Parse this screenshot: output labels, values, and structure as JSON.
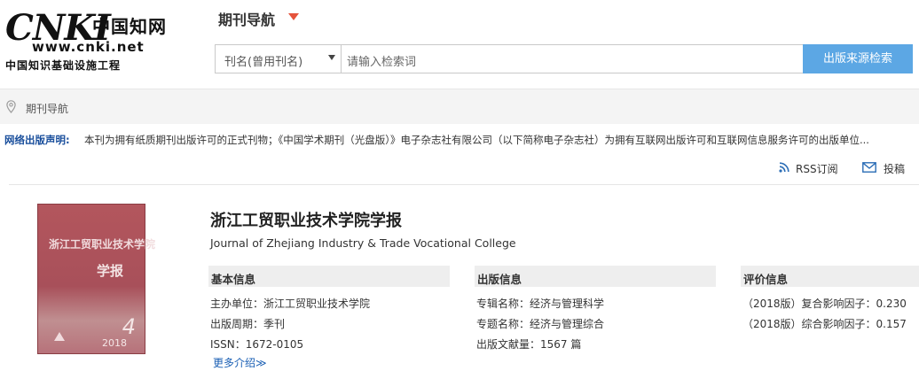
{
  "header": {
    "logo": {
      "brand": "CNKI",
      "cn_name": "中国知网",
      "url": "www.cnki.net",
      "slogan": "中国知识基础设施工程"
    },
    "nav_title": "期刊导航",
    "search": {
      "scope_selected": "刊名(曾用刊名)",
      "placeholder": "请输入检索词",
      "button_label": "出版来源检索"
    }
  },
  "breadcrumb": {
    "label": "期刊导航"
  },
  "notice": {
    "label": "网络出版声明:",
    "text": "本刊为拥有纸质期刊出版许可的正式刊物；《中国学术期刊（光盘版）》电子杂志社有限公司（以下简称电子杂志社）为拥有互联网出版许可和互联网信息服务许可的出版单位..."
  },
  "actions": {
    "rss": "RSS订阅",
    "contribute": "投稿"
  },
  "journal": {
    "cover": {
      "title": "浙江工贸职业技术学院",
      "subtitle": "学报",
      "issue": "4",
      "year": "2018"
    },
    "title_cn": "浙江工贸职业技术学院学报",
    "title_en": "Journal of Zhejiang Industry & Trade Vocational College",
    "basic": {
      "heading": "基本信息",
      "sponsor": "主办单位：浙江工贸职业技术学院",
      "cycle": "出版周期：季刊",
      "issn": "ISSN：1672-0105",
      "more": "更多介绍≫"
    },
    "publication": {
      "heading": "出版信息",
      "album": "专辑名称：经济与管理科学",
      "topic": "专题名称：经济与管理综合",
      "count": "出版文献量：1567 篇"
    },
    "evaluation": {
      "heading": "评价信息",
      "composite": "（2018版）复合影响因子：0.230",
      "comprehensive": "（2018版）综合影响因子：0.157"
    }
  },
  "colors": {
    "accent": "#5ca7e4",
    "notice_label": "#1a4f9c",
    "caret": "#e5533c",
    "link": "#1a5fb4"
  }
}
